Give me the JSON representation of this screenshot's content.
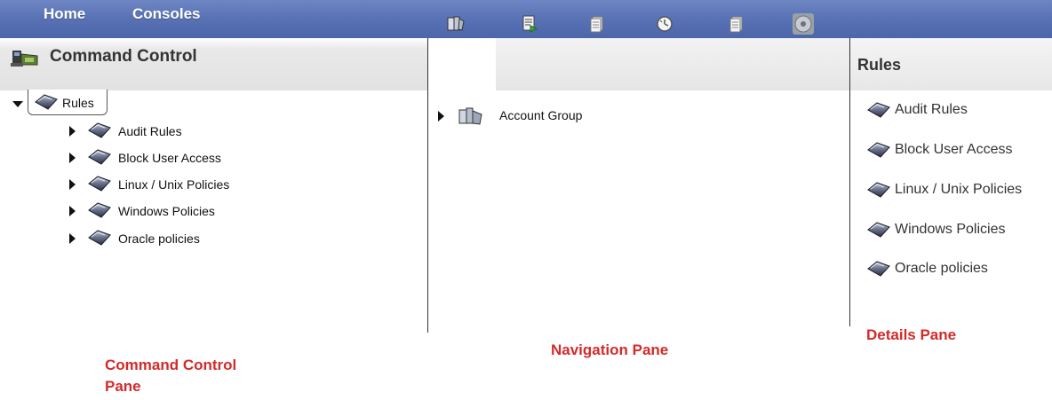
{
  "menu": {
    "home": "Home",
    "consoles": "Consoles"
  },
  "command_control": {
    "title": "Command Control",
    "root": "Rules",
    "items": [
      "Audit Rules",
      "Block User Access",
      "Linux / Unix Policies",
      "Windows Policies",
      "Oracle policies"
    ]
  },
  "navigation": {
    "tabs": [
      "book-tab-icon",
      "run-list-tab-icon",
      "document-tab-icon",
      "clock-tab-icon",
      "list-tab-icon",
      "disk-tab-icon"
    ],
    "items": [
      "Account Group"
    ]
  },
  "details": {
    "title": "Rules",
    "items": [
      "Audit Rules",
      "Block User Access",
      "Linux / Unix Policies",
      "Windows Policies",
      "Oracle policies"
    ]
  },
  "annotations": {
    "command_control_line1": "Command Control",
    "command_control_line2": "Pane",
    "navigation": "Navigation Pane",
    "details": "Details Pane"
  },
  "colors": {
    "menu_bar": "#5a73b5",
    "annotation": "#d42a2a"
  }
}
